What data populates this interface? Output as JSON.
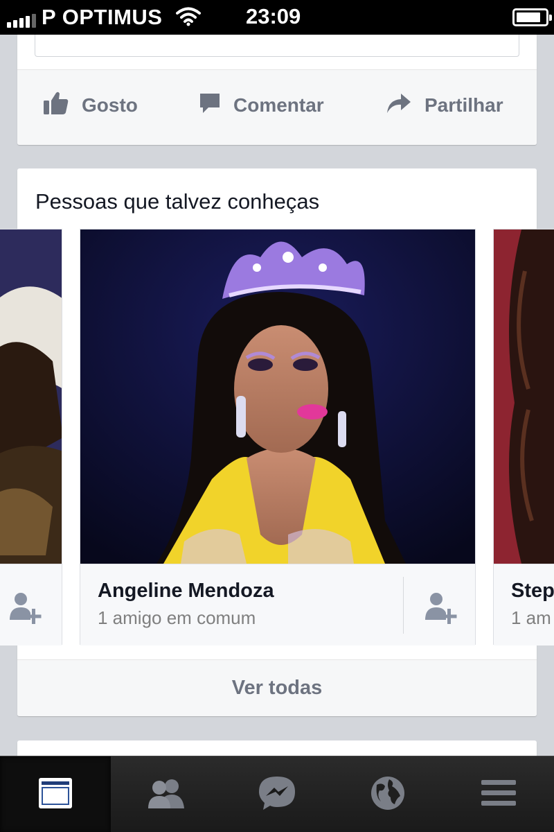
{
  "status_bar": {
    "carrier": "P OPTIMUS",
    "time": "23:09",
    "signal_bars": 4,
    "signal_max": 5,
    "battery_level": 0.85,
    "icons": [
      "signal-icon",
      "wifi-icon",
      "battery-icon"
    ]
  },
  "post_actions": {
    "like_label": "Gosto",
    "comment_label": "Comentar",
    "share_label": "Partilhar",
    "icons": [
      "thumbs-up-icon",
      "comment-icon",
      "share-icon"
    ]
  },
  "pymk": {
    "title": "Pessoas que talvez conheças",
    "people": [
      {
        "name": "",
        "mutual": ""
      },
      {
        "name": "Angeline Mendoza",
        "mutual": "1 amigo em comum"
      },
      {
        "name": "Step",
        "mutual": "1 am"
      }
    ],
    "see_all_label": "Ver todas"
  },
  "tab_bar": {
    "tabs": [
      {
        "icon": "news-feed-icon",
        "active": true
      },
      {
        "icon": "friend-requests-icon",
        "active": false
      },
      {
        "icon": "messenger-icon",
        "active": false
      },
      {
        "icon": "notifications-globe-icon",
        "active": false
      },
      {
        "icon": "menu-icon",
        "active": false
      }
    ]
  },
  "colors": {
    "feed_background": "#d3d6db",
    "action_text": "#6d7380",
    "tab_bar": "#1a1a1a"
  }
}
